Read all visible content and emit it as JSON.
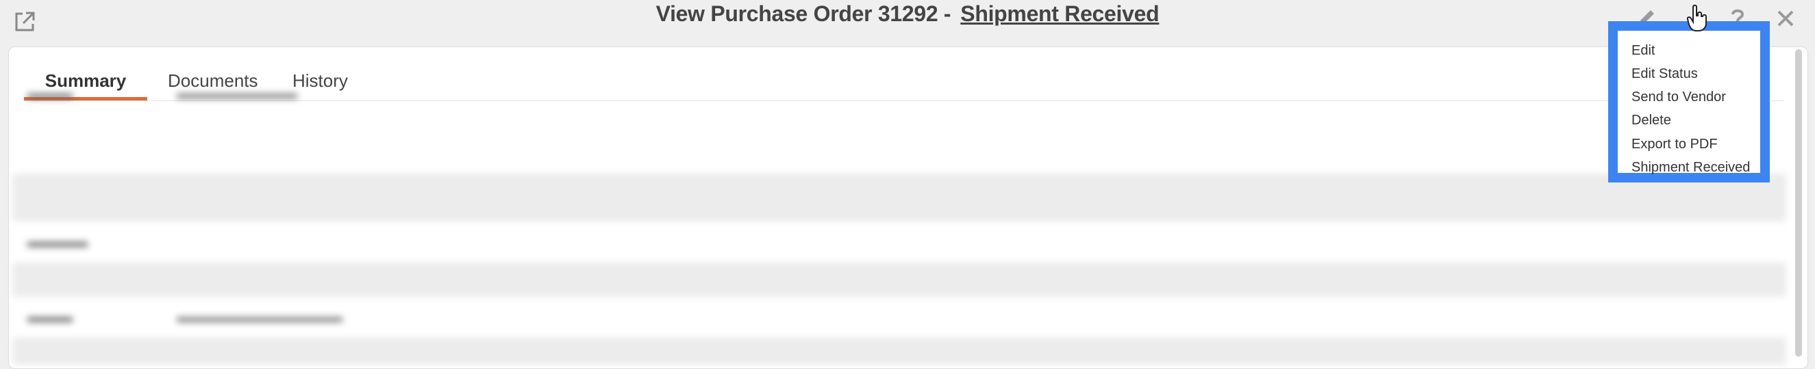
{
  "header": {
    "title": "View Purchase Order 31292 -",
    "status": "Shipment Received"
  },
  "toolbar": {
    "icons": [
      "popout-icon",
      "pencil-icon",
      "cursor-hand-icon",
      "help-icon",
      "close-icon"
    ]
  },
  "tabs": [
    {
      "label": "Summary",
      "active": true
    },
    {
      "label": "Documents",
      "active": false
    },
    {
      "label": "History",
      "active": false
    }
  ],
  "actions_menu": {
    "items": [
      {
        "label": "Edit"
      },
      {
        "label": "Edit Status"
      },
      {
        "label": "Send to Vendor"
      },
      {
        "label": "Delete"
      },
      {
        "label": "Export to PDF"
      },
      {
        "label": "Shipment Received"
      }
    ]
  },
  "colors": {
    "accent_tab": "#e06a3a",
    "highlight_border": "#3d84f0",
    "page_bg": "#efefef"
  }
}
